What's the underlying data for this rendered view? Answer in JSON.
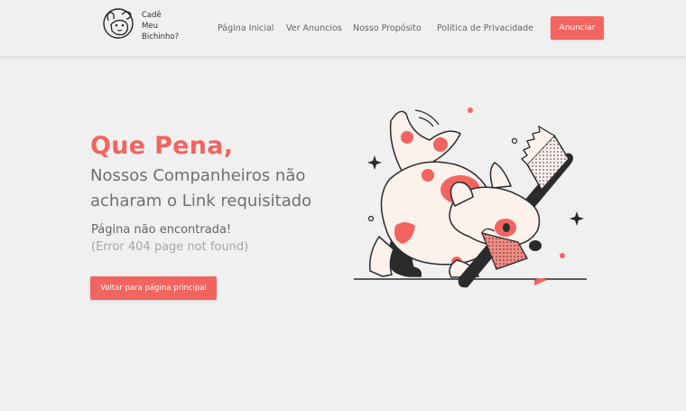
{
  "header": {
    "logo": {
      "line1": "Cadê",
      "line2": "Meu",
      "line3": "Bichinho?"
    },
    "nav": [
      {
        "label": "Página Inicial"
      },
      {
        "label": "Ver Anuncios"
      },
      {
        "label": "Nosso Propósito"
      },
      {
        "label": "Política de Privacidade"
      }
    ],
    "cta_label": "Anunciar"
  },
  "main": {
    "title": "Que Pena,",
    "subtitle_line1": "Nossos Companheiros não",
    "subtitle_line2": "acharam o Link requisitado",
    "not_found": "Página não encontrada!",
    "error_code": "(Error 404 page not found)",
    "back_button": "Voltar para página principal"
  },
  "illustration": {
    "name": "dog-chewing-toothbrush-illustration"
  },
  "colors": {
    "accent": "#f2645f",
    "background": "#f0f0f0",
    "text": "#666666",
    "muted": "#a6a6a6",
    "outline": "#2b2b2b"
  }
}
